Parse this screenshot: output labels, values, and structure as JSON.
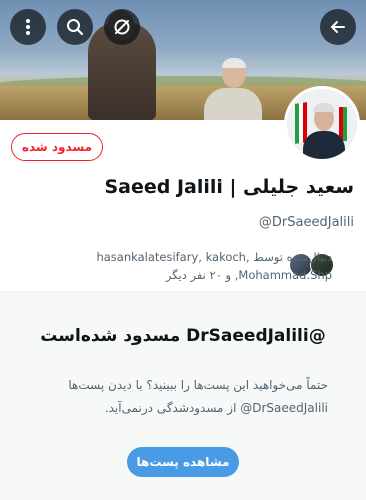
{
  "header": {
    "back_icon": "arrow-left-icon",
    "more_icon": "more-vertical-icon",
    "search_icon": "search-icon",
    "disable_icon": "disabled-icon"
  },
  "profile": {
    "display_name": "سعید جلیلی | Saeed Jalili",
    "handle": "@DrSaeedJalili",
    "blocked_button_label": "مسدود شده",
    "followers_text": "دنبال‌شده توسط hasankalatesifary, kakoch, Mohammad.Shp, و ۲۰ نفر دیگر"
  },
  "blocked_notice": {
    "title": "@DrSaeedJalili مسدود شده‌است",
    "description": "حتماً می‌خواهید این پست‌ها را ببینید؟ با دیدن پست‌ها DrSaeedJalili@ از مسدودشدگی درنمی‌آید.",
    "view_posts_label": "مشاهده پست‌ها"
  },
  "colors": {
    "blocked_red": "#f4212e",
    "accent_blue": "#4a9be6",
    "secondary_text": "#536471"
  }
}
